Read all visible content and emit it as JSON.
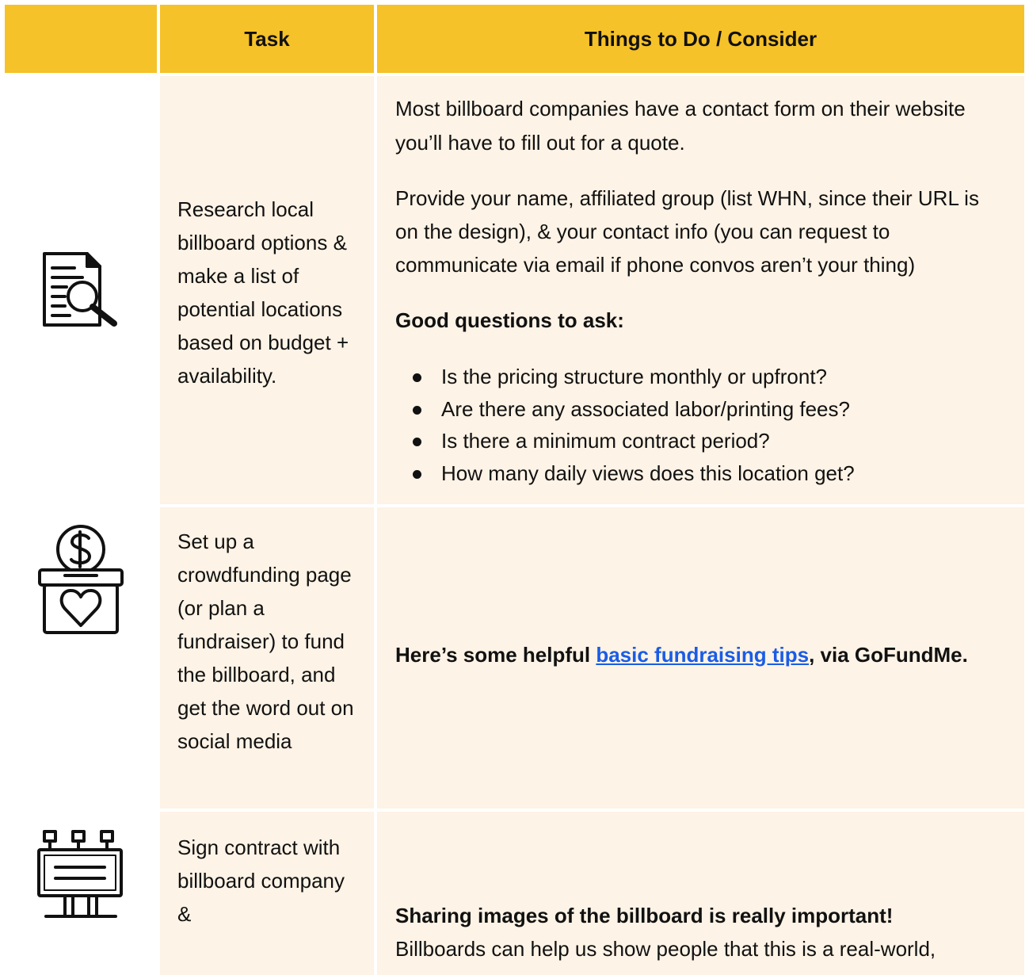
{
  "header": {
    "task": "Task",
    "things": "Things to Do / Consider"
  },
  "rows": [
    {
      "icon": "document-search-icon",
      "task": "Research local billboard options & make a list of potential locations based on budget + availability.",
      "p1": "Most billboard companies have a contact form on their website you’ll have to fill out for a quote.",
      "p2": "Provide your name, affiliated group (list WHN, since their URL is on the design), & your contact info (you can request to communicate via email if phone convos aren’t your thing)",
      "questions_heading": "Good questions to ask:",
      "questions": [
        "Is the pricing structure monthly or upfront?",
        "Are there any associated labor/printing fees?",
        " Is there a minimum contract period?",
        "How many daily views does this location get?"
      ]
    },
    {
      "icon": "donation-box-icon",
      "task": "Set up a crowdfunding page (or plan a fundraiser) to fund the billboard, and get the word out on social media",
      "tip_prefix": "Here’s some helpful ",
      "tip_link": "basic fundraising tips",
      "tip_suffix": ", via GoFundMe."
    },
    {
      "icon": "billboard-icon",
      "task": "Sign contract with billboard company &",
      "bold_line": "Sharing images of the billboard is really important!",
      "text_line": "Billboards can help us show people that this is a real-world,"
    }
  ],
  "colors": {
    "header_bg": "#f6c229",
    "cell_bg": "#fdf3e6",
    "link": "#1a5ce6"
  }
}
